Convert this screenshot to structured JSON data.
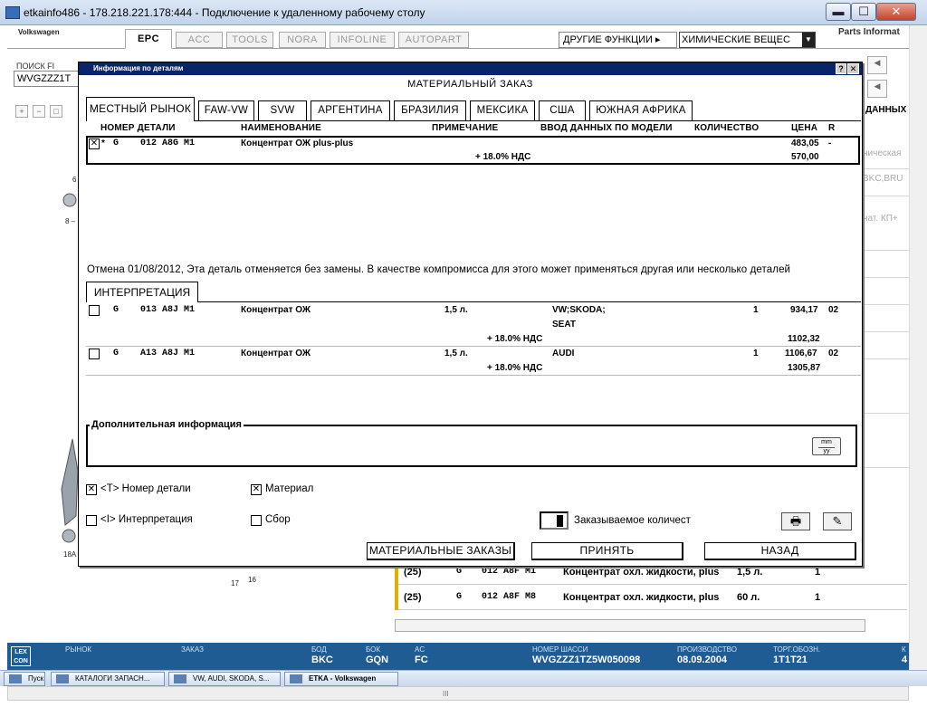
{
  "rdp_window": {
    "title": "etkainfo486 - 178.218.221.178:444 - Подключение к удаленному рабочему столу",
    "min_glyph": "▬",
    "max_glyph": "☐",
    "close_glyph": "✕"
  },
  "app_header": {
    "brand": "Volkswagen",
    "tabs": [
      {
        "label": "EPC",
        "active": true
      },
      {
        "label": "ACC",
        "active": false
      },
      {
        "label": "TOOLS",
        "active": false
      },
      {
        "label": "NORA",
        "active": false
      },
      {
        "label": "INFOLINE",
        "active": false
      },
      {
        "label": "AUTOPART",
        "active": false
      }
    ],
    "other_functions": "ДРУГИЕ ФУНКЦИИ ▸",
    "chemicals_select": "ХИМИЧЕСКИЕ ВЕЩЕС",
    "parts_info": "Parts Informat"
  },
  "background": {
    "search_label": "ПОИСК FI",
    "search_value": "WVGZZZ1T",
    "right_data_label": "ДАННЫХ",
    "right_texts": [
      "ническая",
      "BKC,BRU",
      "нат. КП+"
    ],
    "diagram_labels": [
      "6",
      "8 –",
      "18A",
      "17",
      "16"
    ],
    "rows": [
      {
        "qty_code": "(25)",
        "g": "G",
        "part": "012  A8F M1",
        "name": "Концентрат охл. жидкости, plus",
        "vol": "1,5 л.",
        "count": "1"
      },
      {
        "qty_code": "(25)",
        "g": "G",
        "part": "012  A8F M8",
        "name": "Концентрат охл. жидкости, plus",
        "vol": "60 л.",
        "count": "1"
      }
    ]
  },
  "status_bar": {
    "logo": "LEX CON",
    "fields": [
      {
        "label": "РЫНОК",
        "value": ""
      },
      {
        "label": "ЗАКАЗ",
        "value": ""
      },
      {
        "label": "БОД",
        "value": "BKC"
      },
      {
        "label": "БОК",
        "value": "GQN"
      },
      {
        "label": "AC",
        "value": "FC"
      },
      {
        "label": "НОМЕР ШАССИ",
        "value": "WVGZZZ1TZ5W050098"
      },
      {
        "label": "ПРОИЗВОДСТВО",
        "value": "08.09.2004"
      },
      {
        "label": "ТОРГ.ОБОЗН.",
        "value": "1T1T21"
      },
      {
        "label": "К",
        "value": "4"
      }
    ]
  },
  "taskbar": {
    "items": [
      "Пуск",
      "КАТАЛОГИ ЗАПАСН...",
      "VW, AUDI, SKODA, S...",
      "ETKA - Volkswagen"
    ]
  },
  "dialog": {
    "title": "Информация по деталям",
    "help": "?",
    "close": "✕",
    "heading": "МАТЕРИАЛЬНЫЙ ЗАКАЗ",
    "market_tabs": [
      "МЕСТНЫЙ РЫНОК",
      "FAW-VW",
      "SVW",
      "АРГЕНТИНА",
      "БРАЗИЛИЯ",
      "МЕКСИКА",
      "США",
      "ЮЖНАЯ АФРИКА"
    ],
    "columns": [
      "НОМЕР ДЕТАЛИ",
      "НАИМЕНОВАНИЕ",
      "ПРИМЕЧАНИЕ",
      "ВВОД ДАННЫХ ПО МОДЕЛИ",
      "КОЛИЧЕСТВО",
      "ЦЕНА",
      "R"
    ],
    "selected_part": {
      "checked": true,
      "checkmark": "✕",
      "star": "*",
      "g": "G",
      "number": "012  A8G M1",
      "name": "Концентрат ОЖ plus-plus",
      "vat_note": "+ 18.0% НДС",
      "price": "483,05",
      "price_vat": "570,00",
      "r": "-"
    },
    "cancel_note": "Отмена 01/08/2012, Эта деталь отменяется без замены. В качестве компромисса для этого может применяться другая или несколько деталей",
    "interpretation_tab": "ИНТЕРПРЕТАЦИЯ",
    "alternatives": [
      {
        "g": "G",
        "number": "013  A8J M1",
        "name": "Концентрат ОЖ",
        "note": "1,5 л.",
        "model": "VW;SKODA;",
        "model2": "SEAT",
        "qty": "1",
        "price": "934,17",
        "r": "02",
        "vat_note": "+ 18.0% НДС",
        "price_vat": "1102,32"
      },
      {
        "g": "G",
        "number": "A13  A8J M1",
        "name": "Концентрат ОЖ",
        "note": "1,5 л.",
        "model": "AUDI",
        "model2": "",
        "qty": "1",
        "price": "1106,67",
        "r": "02",
        "vat_note": "+ 18.0% НДС",
        "price_vat": "1305,87"
      }
    ],
    "additional_info_label": "Дополнительная информация",
    "mmyy": {
      "top": "mm",
      "bottom": "yy"
    },
    "options": {
      "part_number": {
        "label": "<T> Номер детали",
        "checked": true
      },
      "material": {
        "label": "Материал",
        "checked": true
      },
      "interpretation": {
        "label": "<I> Интерпретация",
        "checked": false
      },
      "assembly": {
        "label": "Сбор",
        "checked": false
      }
    },
    "checkmark": "✕",
    "order_qty_label": "Заказываемое количест",
    "print_icon": "🖶",
    "edit_icon": "✎",
    "buttons": {
      "material_orders": "МАТЕРИАЛЬНЫЕ ЗАКАЗЫ",
      "accept": "ПРИНЯТЬ",
      "back": "НАЗАД"
    }
  }
}
